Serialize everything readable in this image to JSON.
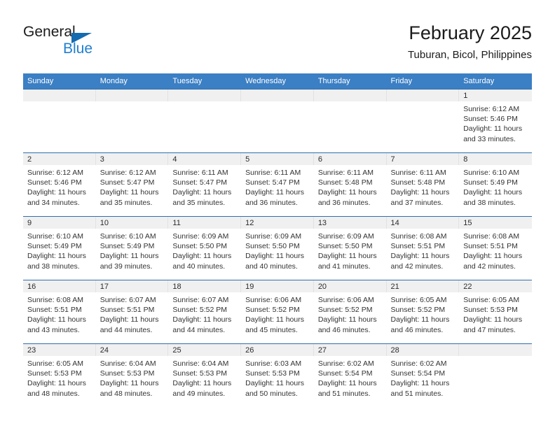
{
  "logo": {
    "word_top": "General",
    "word_bottom": "Blue",
    "triangle_color": "#156bb0",
    "blue_color": "#1f7fd0"
  },
  "header": {
    "title": "February 2025",
    "subtitle": "Tuburan, Bicol, Philippines"
  },
  "theme": {
    "header_row_bg": "#3b7fc4",
    "row_divider": "#2f6fb0",
    "daynum_band_bg": "#f0f0f0"
  },
  "weekdays": [
    "Sunday",
    "Monday",
    "Tuesday",
    "Wednesday",
    "Thursday",
    "Friday",
    "Saturday"
  ],
  "weeks": [
    [
      {
        "day": "",
        "sunrise": "",
        "sunset": "",
        "daylight1": "",
        "daylight2": ""
      },
      {
        "day": "",
        "sunrise": "",
        "sunset": "",
        "daylight1": "",
        "daylight2": ""
      },
      {
        "day": "",
        "sunrise": "",
        "sunset": "",
        "daylight1": "",
        "daylight2": ""
      },
      {
        "day": "",
        "sunrise": "",
        "sunset": "",
        "daylight1": "",
        "daylight2": ""
      },
      {
        "day": "",
        "sunrise": "",
        "sunset": "",
        "daylight1": "",
        "daylight2": ""
      },
      {
        "day": "",
        "sunrise": "",
        "sunset": "",
        "daylight1": "",
        "daylight2": ""
      },
      {
        "day": "1",
        "sunrise": "Sunrise: 6:12 AM",
        "sunset": "Sunset: 5:46 PM",
        "daylight1": "Daylight: 11 hours",
        "daylight2": "and 33 minutes."
      }
    ],
    [
      {
        "day": "2",
        "sunrise": "Sunrise: 6:12 AM",
        "sunset": "Sunset: 5:46 PM",
        "daylight1": "Daylight: 11 hours",
        "daylight2": "and 34 minutes."
      },
      {
        "day": "3",
        "sunrise": "Sunrise: 6:12 AM",
        "sunset": "Sunset: 5:47 PM",
        "daylight1": "Daylight: 11 hours",
        "daylight2": "and 35 minutes."
      },
      {
        "day": "4",
        "sunrise": "Sunrise: 6:11 AM",
        "sunset": "Sunset: 5:47 PM",
        "daylight1": "Daylight: 11 hours",
        "daylight2": "and 35 minutes."
      },
      {
        "day": "5",
        "sunrise": "Sunrise: 6:11 AM",
        "sunset": "Sunset: 5:47 PM",
        "daylight1": "Daylight: 11 hours",
        "daylight2": "and 36 minutes."
      },
      {
        "day": "6",
        "sunrise": "Sunrise: 6:11 AM",
        "sunset": "Sunset: 5:48 PM",
        "daylight1": "Daylight: 11 hours",
        "daylight2": "and 36 minutes."
      },
      {
        "day": "7",
        "sunrise": "Sunrise: 6:11 AM",
        "sunset": "Sunset: 5:48 PM",
        "daylight1": "Daylight: 11 hours",
        "daylight2": "and 37 minutes."
      },
      {
        "day": "8",
        "sunrise": "Sunrise: 6:10 AM",
        "sunset": "Sunset: 5:49 PM",
        "daylight1": "Daylight: 11 hours",
        "daylight2": "and 38 minutes."
      }
    ],
    [
      {
        "day": "9",
        "sunrise": "Sunrise: 6:10 AM",
        "sunset": "Sunset: 5:49 PM",
        "daylight1": "Daylight: 11 hours",
        "daylight2": "and 38 minutes."
      },
      {
        "day": "10",
        "sunrise": "Sunrise: 6:10 AM",
        "sunset": "Sunset: 5:49 PM",
        "daylight1": "Daylight: 11 hours",
        "daylight2": "and 39 minutes."
      },
      {
        "day": "11",
        "sunrise": "Sunrise: 6:09 AM",
        "sunset": "Sunset: 5:50 PM",
        "daylight1": "Daylight: 11 hours",
        "daylight2": "and 40 minutes."
      },
      {
        "day": "12",
        "sunrise": "Sunrise: 6:09 AM",
        "sunset": "Sunset: 5:50 PM",
        "daylight1": "Daylight: 11 hours",
        "daylight2": "and 40 minutes."
      },
      {
        "day": "13",
        "sunrise": "Sunrise: 6:09 AM",
        "sunset": "Sunset: 5:50 PM",
        "daylight1": "Daylight: 11 hours",
        "daylight2": "and 41 minutes."
      },
      {
        "day": "14",
        "sunrise": "Sunrise: 6:08 AM",
        "sunset": "Sunset: 5:51 PM",
        "daylight1": "Daylight: 11 hours",
        "daylight2": "and 42 minutes."
      },
      {
        "day": "15",
        "sunrise": "Sunrise: 6:08 AM",
        "sunset": "Sunset: 5:51 PM",
        "daylight1": "Daylight: 11 hours",
        "daylight2": "and 42 minutes."
      }
    ],
    [
      {
        "day": "16",
        "sunrise": "Sunrise: 6:08 AM",
        "sunset": "Sunset: 5:51 PM",
        "daylight1": "Daylight: 11 hours",
        "daylight2": "and 43 minutes."
      },
      {
        "day": "17",
        "sunrise": "Sunrise: 6:07 AM",
        "sunset": "Sunset: 5:51 PM",
        "daylight1": "Daylight: 11 hours",
        "daylight2": "and 44 minutes."
      },
      {
        "day": "18",
        "sunrise": "Sunrise: 6:07 AM",
        "sunset": "Sunset: 5:52 PM",
        "daylight1": "Daylight: 11 hours",
        "daylight2": "and 44 minutes."
      },
      {
        "day": "19",
        "sunrise": "Sunrise: 6:06 AM",
        "sunset": "Sunset: 5:52 PM",
        "daylight1": "Daylight: 11 hours",
        "daylight2": "and 45 minutes."
      },
      {
        "day": "20",
        "sunrise": "Sunrise: 6:06 AM",
        "sunset": "Sunset: 5:52 PM",
        "daylight1": "Daylight: 11 hours",
        "daylight2": "and 46 minutes."
      },
      {
        "day": "21",
        "sunrise": "Sunrise: 6:05 AM",
        "sunset": "Sunset: 5:52 PM",
        "daylight1": "Daylight: 11 hours",
        "daylight2": "and 46 minutes."
      },
      {
        "day": "22",
        "sunrise": "Sunrise: 6:05 AM",
        "sunset": "Sunset: 5:53 PM",
        "daylight1": "Daylight: 11 hours",
        "daylight2": "and 47 minutes."
      }
    ],
    [
      {
        "day": "23",
        "sunrise": "Sunrise: 6:05 AM",
        "sunset": "Sunset: 5:53 PM",
        "daylight1": "Daylight: 11 hours",
        "daylight2": "and 48 minutes."
      },
      {
        "day": "24",
        "sunrise": "Sunrise: 6:04 AM",
        "sunset": "Sunset: 5:53 PM",
        "daylight1": "Daylight: 11 hours",
        "daylight2": "and 48 minutes."
      },
      {
        "day": "25",
        "sunrise": "Sunrise: 6:04 AM",
        "sunset": "Sunset: 5:53 PM",
        "daylight1": "Daylight: 11 hours",
        "daylight2": "and 49 minutes."
      },
      {
        "day": "26",
        "sunrise": "Sunrise: 6:03 AM",
        "sunset": "Sunset: 5:53 PM",
        "daylight1": "Daylight: 11 hours",
        "daylight2": "and 50 minutes."
      },
      {
        "day": "27",
        "sunrise": "Sunrise: 6:02 AM",
        "sunset": "Sunset: 5:54 PM",
        "daylight1": "Daylight: 11 hours",
        "daylight2": "and 51 minutes."
      },
      {
        "day": "28",
        "sunrise": "Sunrise: 6:02 AM",
        "sunset": "Sunset: 5:54 PM",
        "daylight1": "Daylight: 11 hours",
        "daylight2": "and 51 minutes."
      },
      {
        "day": "",
        "sunrise": "",
        "sunset": "",
        "daylight1": "",
        "daylight2": ""
      }
    ]
  ]
}
